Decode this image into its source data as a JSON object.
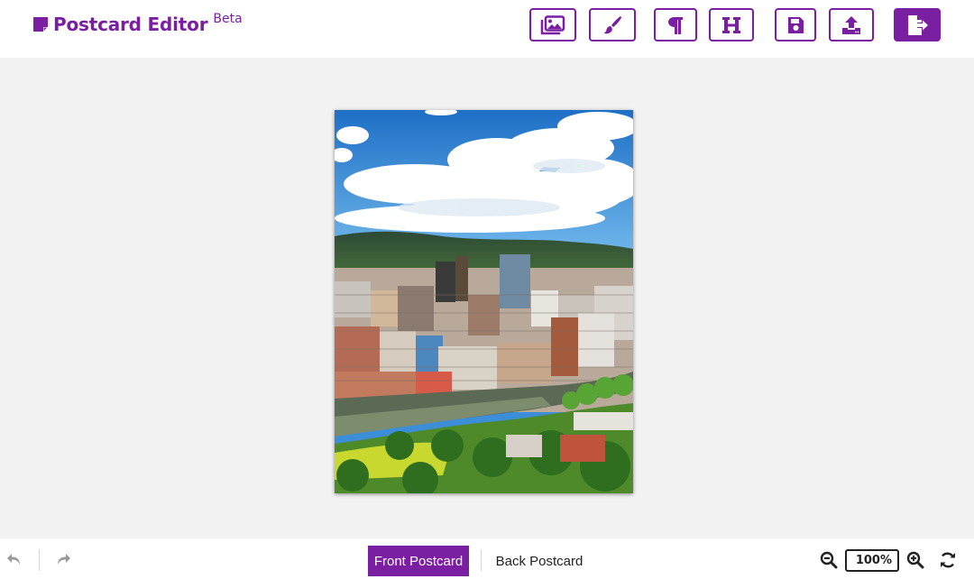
{
  "app": {
    "title": "Postcard Editor",
    "badge": "Beta",
    "accent_color": "#7b1fa2"
  },
  "toolbar": [
    {
      "icon": "image-gallery-icon",
      "action": "images"
    },
    {
      "icon": "paintbrush-icon",
      "action": "design"
    },
    {
      "icon": "paragraph-icon",
      "action": "paragraph-text"
    },
    {
      "icon": "heading-icon",
      "action": "heading-text"
    },
    {
      "icon": "save-icon",
      "action": "save"
    },
    {
      "icon": "upload-icon",
      "action": "upload"
    },
    {
      "icon": "exit-icon",
      "action": "exit"
    }
  ],
  "canvas": {
    "image_subject": "city skyline photo"
  },
  "footer": {
    "undo_icon": "undo-icon",
    "redo_icon": "redo-icon",
    "tabs": [
      {
        "label": "Front Postcard",
        "active": true
      },
      {
        "label": "Back Postcard",
        "active": false
      }
    ],
    "zoom": "100%",
    "zoom_out_icon": "zoom-out-icon",
    "zoom_in_icon": "zoom-in-icon",
    "refresh_icon": "refresh-icon"
  }
}
